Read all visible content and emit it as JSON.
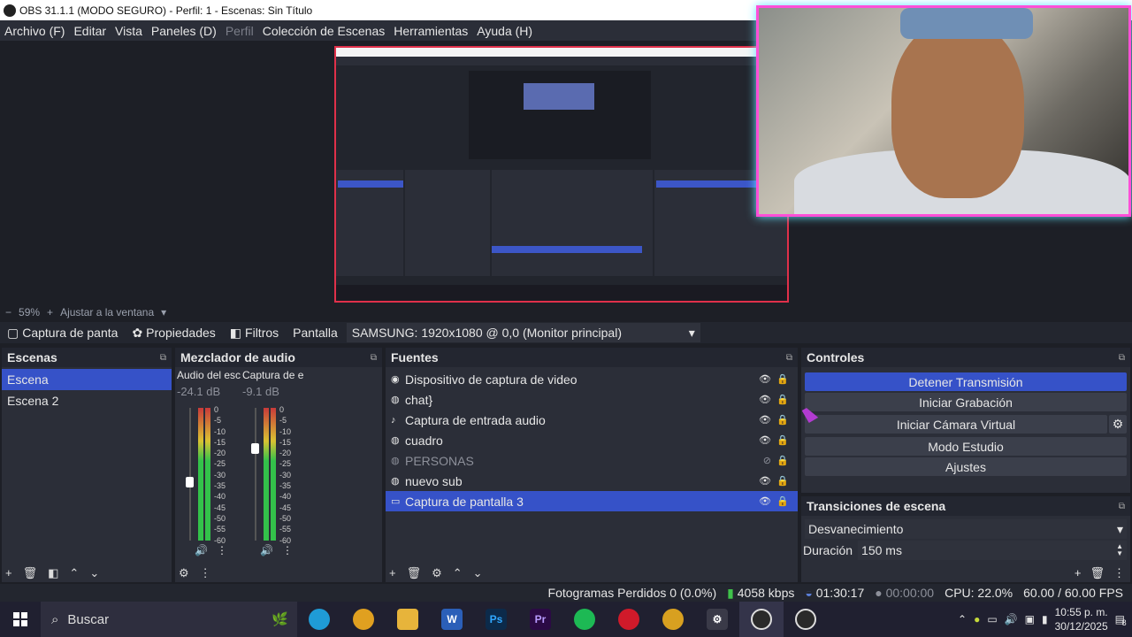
{
  "window": {
    "title": "OBS 31.1.1 (MODO SEGURO) - Perfil: 1 - Escenas: Sin Título"
  },
  "menu": [
    "Archivo (F)",
    "Editar",
    "Vista",
    "Paneles (D)",
    "Perfil",
    "Colección de Escenas",
    "Herramientas",
    "Ayuda (H)"
  ],
  "zoom": {
    "value": "59%",
    "fit_label": "Ajustar a la ventana"
  },
  "source_bar": {
    "source_name": "Captura de panta",
    "properties": "Propiedades",
    "filters": "Filtros",
    "screen_label": "Pantalla",
    "screen_value": "SAMSUNG: 1920x1080 @ 0,0 (Monitor principal)"
  },
  "scenes": {
    "title": "Escenas",
    "items": [
      "Escena",
      "Escena 2"
    ],
    "selected": 0
  },
  "mixer": {
    "title": "Mezclador de audio",
    "channels": [
      {
        "name": "Audio del esc",
        "db": "-24.1 dB",
        "level": 0.55
      },
      {
        "name": "Captura de e",
        "db": "-9.1 dB",
        "level": 0.85
      }
    ],
    "scale": [
      "0",
      "-5",
      "-10",
      "-15",
      "-20",
      "-25",
      "-30",
      "-35",
      "-40",
      "-45",
      "-50",
      "-55",
      "-60"
    ]
  },
  "sources": {
    "title": "Fuentes",
    "items": [
      {
        "icon": "camera-icon",
        "label": "Dispositivo de captura de video",
        "visible": true
      },
      {
        "icon": "globe-icon",
        "label": "chat}",
        "visible": true
      },
      {
        "icon": "mic-icon",
        "label": "Captura de entrada audio",
        "visible": true
      },
      {
        "icon": "globe-icon",
        "label": "cuadro",
        "visible": true
      },
      {
        "icon": "globe-icon",
        "label": "PERSONAS",
        "visible": false
      },
      {
        "icon": "globe-icon",
        "label": "nuevo sub",
        "visible": true
      },
      {
        "icon": "monitor-icon",
        "label": "Captura de pantalla 3",
        "visible": true
      }
    ]
  },
  "controls": {
    "title": "Controles",
    "buttons": [
      "Detener Transmisión",
      "Iniciar Grabación",
      "Iniciar Cámara Virtual",
      "Modo Estudio",
      "Ajustes"
    ]
  },
  "transitions": {
    "title": "Transiciones de escena",
    "selected": "Desvanecimiento",
    "duration_label": "Duración",
    "duration_value": "150 ms"
  },
  "status": {
    "dropped": "Fotogramas Perdidos 0 (0.0%)",
    "bitrate": "4058 kbps",
    "stream_time": "01:30:17",
    "rec_time": "00:00:00",
    "cpu": "CPU: 22.0%",
    "fps": "60.00 / 60.00 FPS"
  },
  "taskbar": {
    "search_placeholder": "Buscar",
    "time": "10:55 p. m.",
    "date": "30/12/2025",
    "notifications": "8",
    "apps": [
      {
        "icon": "edge-icon",
        "label": "",
        "color": "#1f9bd6"
      },
      {
        "icon": "chrome-icon",
        "label": "",
        "color": "#e0a020"
      },
      {
        "icon": "folder-icon",
        "label": "",
        "color": "#e7b43b"
      },
      {
        "icon": "word-icon",
        "label": "W",
        "color": "#2b5fb8"
      },
      {
        "icon": "photoshop-icon",
        "label": "Ps",
        "color": "#0c2a4a"
      },
      {
        "icon": "premiere-icon",
        "label": "Pr",
        "color": "#2b0a45"
      },
      {
        "icon": "spotify-icon",
        "label": "",
        "color": "#1db954"
      },
      {
        "icon": "opera-icon",
        "label": "",
        "color": "#d01a2a"
      },
      {
        "icon": "chrome-icon",
        "label": "",
        "color": "#d8a020"
      },
      {
        "icon": "settings-icon",
        "label": "⚙",
        "color": "#3a3a48"
      },
      {
        "icon": "obs-icon",
        "label": "",
        "color": "#2a2a2a"
      },
      {
        "icon": "obs-icon",
        "label": "",
        "color": "#2a2a2a"
      }
    ]
  }
}
